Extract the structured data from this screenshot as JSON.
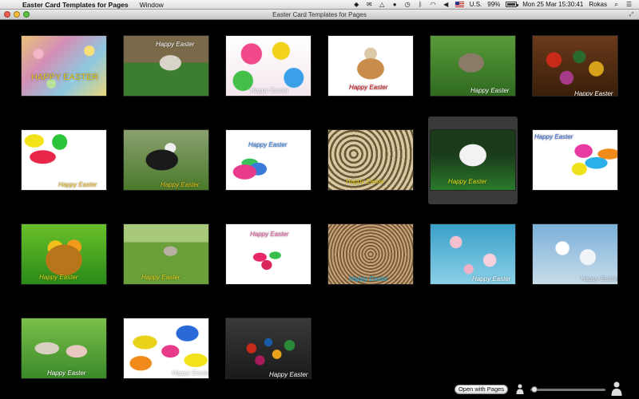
{
  "menubar": {
    "app_name": "Easter Card Templates for Pages",
    "menus": [
      "Window"
    ],
    "status": {
      "input_source": "U.S.",
      "battery": "99%",
      "datetime": "Mon 25 Mar  15:30:41",
      "user": "Rokas"
    }
  },
  "window": {
    "title": "Easter Card Templates for Pages"
  },
  "templates": [
    {
      "caption": "HAPPY EASTER",
      "caption_color": "#e8c21a",
      "bg": "radial-gradient(circle at 20% 30%, #f3b6c8 0 6%, transparent 7%), radial-gradient(circle at 60% 70%, #9fd3e8 0 6%, transparent 7%), radial-gradient(circle at 80% 25%, #f5e07a 0 6%, transparent 7%), radial-gradient(circle at 35% 80%, #b9e39a 0 6%, transparent 7%), linear-gradient(135deg,#e9c27b,#d48fb5,#8fc8e0,#e8d77a)"
    },
    {
      "caption": "Happy Easter",
      "caption_color": "#ffffff",
      "bg": "radial-gradient(ellipse at 55% 45%, #d9d4c9 0 16%, transparent 17%), linear-gradient(#7a6a4a 0 45%, #3d7d2f 45% 100%)"
    },
    {
      "caption": "Happy Easter",
      "caption_color": "#ffffff",
      "bg": "radial-gradient(circle at 30% 30%, #f04a8a 0 14%, transparent 15%), radial-gradient(circle at 65% 25%, #f2d21a 0 12%, transparent 13%), radial-gradient(circle at 80% 70%, #3aa0e8 0 12%, transparent 13%), radial-gradient(circle at 20% 75%, #44c04a 0 12%, transparent 13%), linear-gradient(#ffffff,#f3e6ee)"
    },
    {
      "caption": "Happy Easter",
      "caption_color": "#cc1111",
      "bg": "radial-gradient(ellipse at 50% 55%, #c98c4a 0 22%, transparent 23%), radial-gradient(circle at 50% 30%, #d9c9a6 0 10%, transparent 11%), #ffffff"
    },
    {
      "caption": "Happy Easter",
      "caption_color": "#ffffff",
      "bg": "radial-gradient(ellipse at 48% 45%, #8a7a66 0 20%, transparent 21%), linear-gradient(#5a9a3a,#2f6a1f)"
    },
    {
      "caption": "Happy Easter",
      "caption_color": "#ffffff",
      "bg": "radial-gradient(circle at 25% 40%, #c82a1a 0 10%, transparent 11%), radial-gradient(circle at 55% 35%, #2a6a2a 0 10%, transparent 11%), radial-gradient(circle at 75% 55%, #d8a21a 0 10%, transparent 11%), radial-gradient(circle at 40% 70%, #a83a8a 0 10%, transparent 11%), linear-gradient(#6a3a1a,#3a1f0a)"
    },
    {
      "caption": "Happy Easter",
      "caption_color": "#e8b41a",
      "bg": "radial-gradient(ellipse at 25% 45%, #e8264a 0 14%, transparent 15%), radial-gradient(ellipse at 45% 20%, #2cc43a 0 11%, transparent 12%), radial-gradient(ellipse at 15% 18%, #f2e21a 0 9%, transparent 10%), #ffffff"
    },
    {
      "caption": "Happy Easter",
      "caption_color": "#e8c21a",
      "bg": "radial-gradient(ellipse at 45% 50%, #1a1a1a 0 24%, transparent 25%), radial-gradient(ellipse at 55% 30%, #eeeeee 0 8%, transparent 9%), linear-gradient(#8aa070,#4a7a2a)"
    },
    {
      "caption": "Happy Easter",
      "caption_color": "#2a7ae0",
      "bg": "radial-gradient(ellipse at 22% 70%, #e83a8a 0 12%, transparent 13%), radial-gradient(ellipse at 38% 65%, #3a7ad8 0 11%, transparent 12%), radial-gradient(ellipse at 28% 55%, #3ac05a 0 9%, transparent 10%), #ffffff"
    },
    {
      "caption": "Happy Easter",
      "caption_color": "#e8d21a",
      "bg": "repeating-radial-gradient(circle at 30% 40%, #d8c9a0 0 4%, #6a5a3a 4% 7%), linear-gradient(#9a8a5a,#4a3a1a)"
    },
    {
      "caption": "Happy Easter",
      "caption_color": "#e8e21a",
      "bg": "radial-gradient(ellipse at 50% 42%, #f2f2f2 0 22%, transparent 23%), linear-gradient(#1a3a1a 0 40%, #2a7a2a 100%)"
    },
    {
      "caption": "Happy Easter",
      "caption_color": "#3a6ad8",
      "bg": "radial-gradient(ellipse at 60% 35%, #e83aa0 0 12%, transparent 13%), radial-gradient(ellipse at 75% 55%, #2ab0e8 0 12%, transparent 13%), radial-gradient(ellipse at 55% 65%, #f0e21a 0 11%, transparent 12%), radial-gradient(ellipse at 90% 40%, #f08a1a 0 10%, transparent 11%), #ffffff"
    },
    {
      "caption": "Happy Easter",
      "caption_color": "#e8d21a",
      "bg": "radial-gradient(ellipse at 50% 60%, #b8761a 0 30%, transparent 31%), radial-gradient(circle at 40% 40%, #f2c21a 0 12%, transparent 13%), radial-gradient(circle at 62% 38%, #f29a1a 0 11%, transparent 12%), linear-gradient(#6ac02a,#2a8a1a)"
    },
    {
      "caption": "Happy Easter",
      "caption_color": "#e8d21a",
      "bg": "radial-gradient(ellipse at 55% 45%, #b8b0a0 0 10%, transparent 11%), linear-gradient(#a8c87a 0 30%, #6aa03a 30% 100%)"
    },
    {
      "caption": "Happy Easter",
      "caption_color": "#e85a9a",
      "bg": "radial-gradient(ellipse at 40% 55%, #e8266a 0 9%, transparent 10%), radial-gradient(ellipse at 58% 52%, #3ac04a 0 8%, transparent 9%), radial-gradient(ellipse at 48% 68%, #d8265a 0 8%, transparent 9%), #ffffff"
    },
    {
      "caption": "Happy Easter",
      "caption_color": "#2ab8e8",
      "bg": "repeating-radial-gradient(circle at 50% 50%, #c8a87a 0 3%, #7a5a3a 3% 6%), #ffffff"
    },
    {
      "caption": "Happy Easter",
      "caption_color": "#ffffff",
      "bg": "radial-gradient(circle at 30% 30%, #f4c0d0 0 8%, transparent 9%), radial-gradient(circle at 70% 60%, #f7d0de 0 9%, transparent 10%), radial-gradient(circle at 45% 75%, #f0b0c8 0 7%, transparent 8%), linear-gradient(#3aa0c8,#8ad0e8)"
    },
    {
      "caption": "Happy Easter",
      "caption_color": "#d8e8f0",
      "bg": "radial-gradient(circle at 35% 40%, #ffffff 0 10%, transparent 11%), radial-gradient(circle at 65% 55%, #f0f4f8 0 12%, transparent 13%), linear-gradient(#7ab0d8,#c8dcea)"
    },
    {
      "caption": "Happy Easter",
      "caption_color": "#ffffff",
      "bg": "radial-gradient(ellipse at 30% 50%, #d8d0c0 0 14%, transparent 15%), radial-gradient(ellipse at 65% 55%, #e8c8c0 0 13%, transparent 14%), linear-gradient(#7ac04a,#3a8a2a)"
    },
    {
      "caption": "Happy Easter",
      "caption_color": "#ffffff",
      "bg": "radial-gradient(ellipse at 25% 40%, #e8d21a 0 13%, transparent 14%), radial-gradient(ellipse at 55% 55%, #e83a8a 0 13%, transparent 14%), radial-gradient(ellipse at 75% 25%, #2a6ad8 0 12%, transparent 13%), radial-gradient(ellipse at 20% 75%, #f08a1a 0 11%, transparent 12%), radial-gradient(ellipse at 85% 70%, #f2e21a 0 11%, transparent 12%), #ffffff"
    },
    {
      "caption": "Happy Easter",
      "caption_color": "#ffffff",
      "bg": "radial-gradient(circle at 30% 50%, #c82a1a 0 7%, transparent 8%), radial-gradient(circle at 50% 40%, #1a5aa8 0 7%, transparent 8%), radial-gradient(circle at 60% 60%, #e8a21a 0 7%, transparent 8%), radial-gradient(circle at 40% 70%, #a81a5a 0 7%, transparent 8%), radial-gradient(circle at 75% 45%, #2a8a3a 0 7%, transparent 8%), linear-gradient(#3a3a3a,#1a1a1a)"
    }
  ],
  "bottom": {
    "open_button_label": "Open with Pages",
    "zoom_level": 0.05
  }
}
